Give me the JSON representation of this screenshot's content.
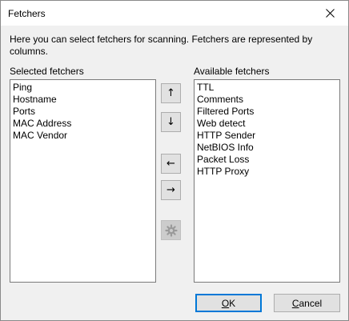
{
  "window": {
    "title": "Fetchers",
    "close_glyph": "×"
  },
  "description": "Here you can select fetchers for scanning. Fetchers are represented by columns.",
  "selected": {
    "label": "Selected fetchers",
    "items": [
      "Ping",
      "Hostname",
      "Ports",
      "MAC Address",
      "MAC Vendor"
    ]
  },
  "available": {
    "label": "Available fetchers",
    "items": [
      "TTL",
      "Comments",
      "Filtered Ports",
      "Web detect",
      "HTTP Sender",
      "NetBIOS Info",
      "Packet Loss",
      "HTTP Proxy"
    ]
  },
  "tools": {
    "move_up": "↑",
    "move_down": "↓",
    "add_left": "←",
    "remove_right": "→",
    "settings_icon": "gear-icon"
  },
  "buttons": {
    "ok": {
      "mnemonic": "O",
      "rest": "K"
    },
    "cancel": {
      "mnemonic": "C",
      "rest": "ancel"
    }
  },
  "colors": {
    "dialog_bg": "#f0f0f0",
    "default_button_border": "#0078d7",
    "button_face": "#e1e1e1"
  }
}
